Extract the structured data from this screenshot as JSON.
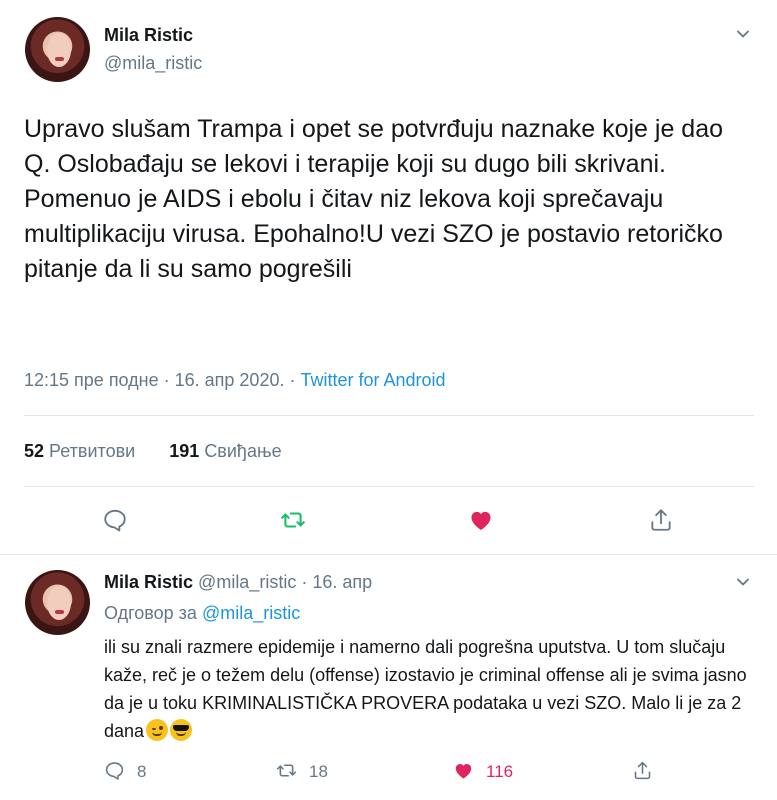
{
  "main_tweet": {
    "author_name": "Mila Ristic",
    "author_handle": "@mila_ristic",
    "text": "Upravo slušam Trampa i opet se potvrđuju naznake koje je dao Q. Oslobađaju se lekovi i terapije koji su dugo bili skrivani. Pomenuo je AIDS i ebolu i čitav niz lekova koji sprečavaju multiplikaciju virusa. Epohalno!U vezi SZO je postavio retoričko pitanje da li su samo pogrešili",
    "time": "12:15 пре подне · 16. апр 2020. · ",
    "source": "Twitter for Android",
    "retweets_count": "52",
    "retweets_label": "Ретвитови",
    "likes_count": "191",
    "likes_label": "Свиђање",
    "liked": true
  },
  "reply_tweet": {
    "author_name": "Mila Ristic",
    "author_handle": "@mila_ristic",
    "date": " · 16. апр",
    "replying_to_label": "Одговор за ",
    "replying_to_handle": "@mila_ristic",
    "text": "ili su znali razmere epidemije i namerno dali pogrešna uputstva. U tom slučaju kaže, reč je o težem delu (offense) izostavio je criminal offense ali je svima jasno da je u toku KRIMINALISTIČKA PROVERA podataka u vezi SZO. Malo li je za 2 dana",
    "emojis": [
      "winking-face",
      "smiling-face-with-sunglasses"
    ],
    "reply_count": "8",
    "retweet_count": "18",
    "like_count": "116"
  },
  "colors": {
    "link": "#1b95e0",
    "muted": "#657786",
    "retweet_green": "#17bf63",
    "like_red": "#e0245e",
    "divider": "#e1e8ed"
  }
}
